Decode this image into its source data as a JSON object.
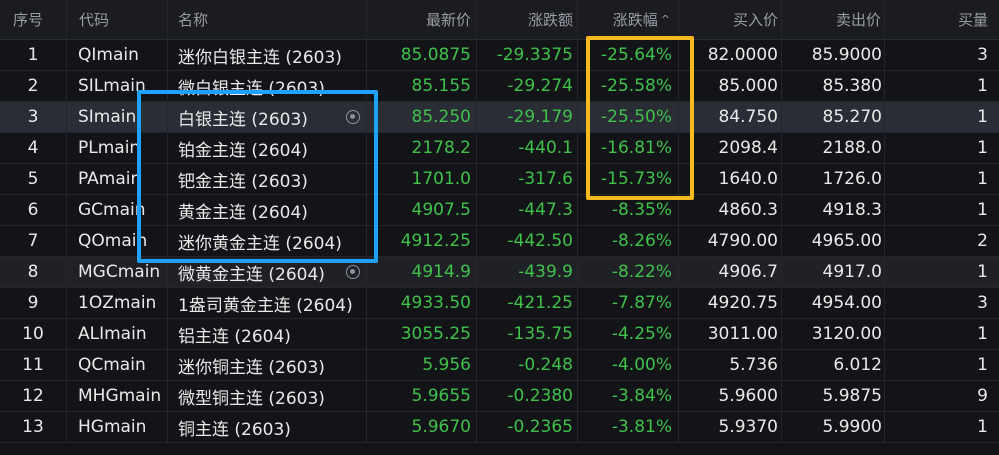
{
  "header": {
    "idx": "序号",
    "code": "代码",
    "name": "名称",
    "last": "最新价",
    "change": "涨跌额",
    "pct": "涨跌幅",
    "bid": "买入价",
    "ask": "卖出价",
    "qty": "买量",
    "sort_icon": "^"
  },
  "rows": [
    {
      "idx": "1",
      "code": "QImain",
      "name": "迷你白银主连 (2603)",
      "last": "85.0875",
      "change": "-29.3375",
      "pct": "-25.64%",
      "bid": "82.0000",
      "ask": "85.9000",
      "qty": "3"
    },
    {
      "idx": "2",
      "code": "SILmain",
      "name": "微白银主连 (2603)",
      "last": "85.155",
      "change": "-29.274",
      "pct": "-25.58%",
      "bid": "85.000",
      "ask": "85.380",
      "qty": "1"
    },
    {
      "idx": "3",
      "code": "SImain",
      "name": "白银主连 (2603)",
      "last": "85.250",
      "change": "-29.179",
      "pct": "-25.50%",
      "bid": "84.750",
      "ask": "85.270",
      "qty": "1"
    },
    {
      "idx": "4",
      "code": "PLmain",
      "name": "铂金主连 (2604)",
      "last": "2178.2",
      "change": "-440.1",
      "pct": "-16.81%",
      "bid": "2098.4",
      "ask": "2188.0",
      "qty": "1"
    },
    {
      "idx": "5",
      "code": "PAmain",
      "name": "钯金主连 (2603)",
      "last": "1701.0",
      "change": "-317.6",
      "pct": "-15.73%",
      "bid": "1640.0",
      "ask": "1726.0",
      "qty": "1"
    },
    {
      "idx": "6",
      "code": "GCmain",
      "name": "黄金主连 (2604)",
      "last": "4907.5",
      "change": "-447.3",
      "pct": "-8.35%",
      "bid": "4860.3",
      "ask": "4918.3",
      "qty": "1"
    },
    {
      "idx": "7",
      "code": "QOmain",
      "name": "迷你黄金主连 (2604)",
      "last": "4912.25",
      "change": "-442.50",
      "pct": "-8.26%",
      "bid": "4790.00",
      "ask": "4965.00",
      "qty": "2"
    },
    {
      "idx": "8",
      "code": "MGCmain",
      "name": "微黄金主连 (2604)",
      "last": "4914.9",
      "change": "-439.9",
      "pct": "-8.22%",
      "bid": "4906.7",
      "ask": "4917.0",
      "qty": "1"
    },
    {
      "idx": "9",
      "code": "1OZmain",
      "name": "1盎司黄金主连 (2604)",
      "last": "4933.50",
      "change": "-421.25",
      "pct": "-7.87%",
      "bid": "4920.75",
      "ask": "4954.00",
      "qty": "3"
    },
    {
      "idx": "10",
      "code": "ALImain",
      "name": "铝主连 (2604)",
      "last": "3055.25",
      "change": "-135.75",
      "pct": "-4.25%",
      "bid": "3011.00",
      "ask": "3120.00",
      "qty": "1"
    },
    {
      "idx": "11",
      "code": "QCmain",
      "name": "迷你铜主连 (2603)",
      "last": "5.956",
      "change": "-0.248",
      "pct": "-4.00%",
      "bid": "5.736",
      "ask": "6.012",
      "qty": "1"
    },
    {
      "idx": "12",
      "code": "MHGmain",
      "name": "微型铜主连 (2603)",
      "last": "5.9655",
      "change": "-0.2380",
      "pct": "-3.84%",
      "bid": "5.9600",
      "ask": "5.9875",
      "qty": "9"
    },
    {
      "idx": "13",
      "code": "HGmain",
      "name": "铜主连 (2603)",
      "last": "5.9670",
      "change": "-0.2365",
      "pct": "-3.81%",
      "bid": "5.9370",
      "ask": "5.9900",
      "qty": "1"
    }
  ],
  "colors": {
    "background": "#131418",
    "down_green": "#3fc14a",
    "annotation_blue": "#1fa2ff",
    "annotation_yellow": "#f6b91e"
  },
  "icons": {
    "watch": "eye-icon",
    "sort": "sort-ascending-icon"
  }
}
